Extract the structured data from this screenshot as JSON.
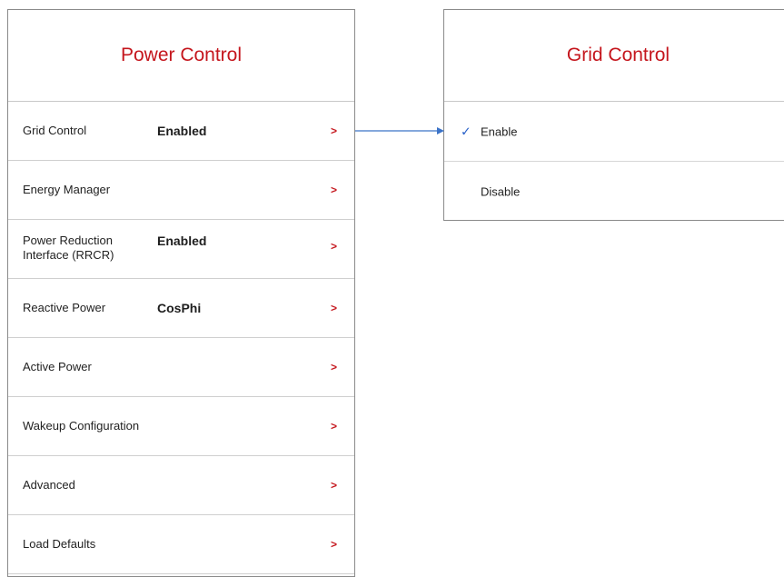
{
  "power_control": {
    "title": "Power Control",
    "items": [
      {
        "label": "Grid Control",
        "value": "Enabled",
        "chevron": ">"
      },
      {
        "label": "Energy Manager",
        "value": "",
        "chevron": ">"
      },
      {
        "label": "Power Reduction",
        "label_line2": "Interface (RRCR)",
        "value": "Enabled",
        "chevron": ">"
      },
      {
        "label": "Reactive Power",
        "value": "CosPhi",
        "chevron": ">"
      },
      {
        "label": "Active Power",
        "value": "",
        "chevron": ">"
      },
      {
        "label": "Wakeup Configuration",
        "value": "",
        "chevron": ">"
      },
      {
        "label": "Advanced",
        "value": "",
        "chevron": ">"
      },
      {
        "label": "Load Defaults",
        "value": "",
        "chevron": ">"
      }
    ]
  },
  "grid_control": {
    "title": "Grid Control",
    "check_mark": "✓",
    "options": [
      {
        "label": "Enable",
        "selected": true
      },
      {
        "label": "Disable",
        "selected": false
      }
    ]
  },
  "colors": {
    "title_red": "#c5161d",
    "chevron_red": "#c5161d",
    "check_blue": "#2a62c9",
    "arrow_blue": "#3b73c8",
    "panel_border": "#8a8a8a"
  }
}
